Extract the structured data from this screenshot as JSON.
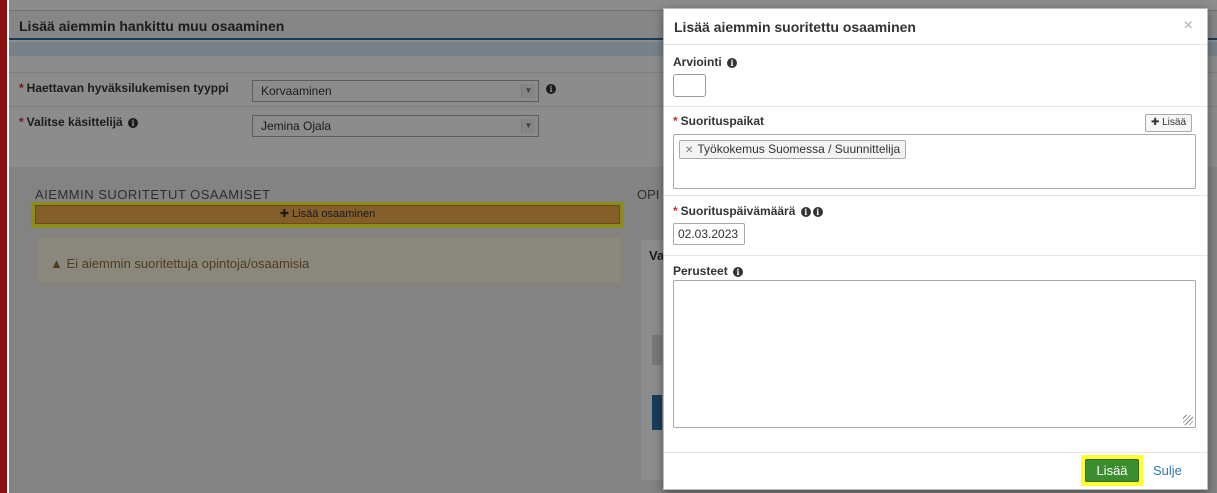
{
  "background": {
    "panel_title": "Lisää aiemmin hankittu muu osaaminen",
    "type_label": "Haettavan hyväksilukemisen tyyppi",
    "type_value": "Korvaaminen",
    "handler_label": "Valitse käsittelijä",
    "handler_value": "Jemina Ojala",
    "section_title": "AIEMMIN SUORITETUT OSAAMISET",
    "section_title_right": "OPI",
    "add_competence_label": "Lisää osaaminen",
    "no_studies_warning": "Ei aiemmin suoritettuja opintoja/osaamisia",
    "right_fragment": "Va"
  },
  "modal": {
    "title": "Lisää aiemmin suoritettu osaaminen",
    "close_glyph": "×",
    "assessment_label": "Arviointi",
    "places_label": "Suorituspaikat",
    "places_add_label": "Lisää",
    "places_tag": "Työkokemus Suomessa / Suunnittelija",
    "date_label": "Suorituspäivämäärä",
    "date_value": "02.03.2023",
    "grounds_label": "Perusteet",
    "submit_label": "Lisää",
    "close_label": "Sulje"
  },
  "colors": {
    "highlight": "#ffff33",
    "submit_green": "#3c8d2f",
    "link_blue": "#337ab7",
    "warning_bg": "#fcf8e3"
  }
}
